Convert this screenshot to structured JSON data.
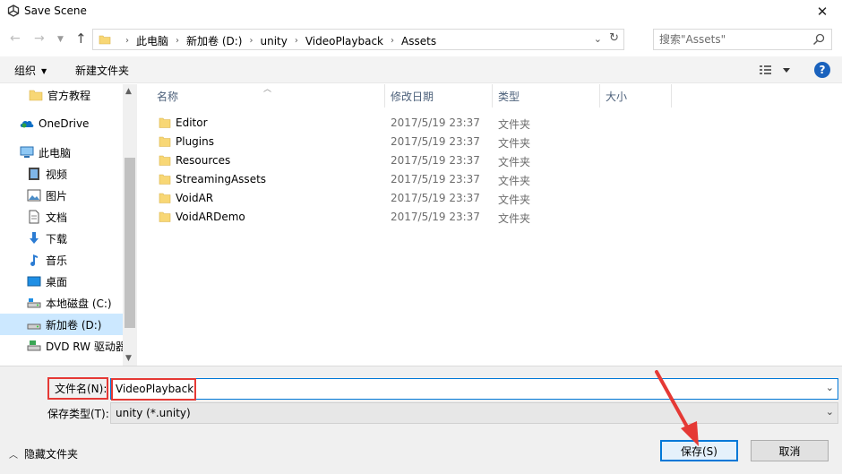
{
  "window": {
    "title": "Save Scene",
    "close_glyph": "✕"
  },
  "address": {
    "crumbs": [
      "此电脑",
      "新加卷 (D:)",
      "unity",
      "VideoPlayback",
      "Assets"
    ],
    "search_placeholder": "搜索\"Assets\""
  },
  "toolbar": {
    "organize_label": "组织",
    "new_folder_label": "新建文件夹",
    "help_label": "?"
  },
  "nav_pane": {
    "items": [
      {
        "label": "官方教程",
        "icon": "folder-icon"
      },
      {
        "label": "OneDrive",
        "icon": "onedrive-icon"
      },
      {
        "label": "此电脑",
        "icon": "computer-icon"
      },
      {
        "label": "视频",
        "icon": "video-icon"
      },
      {
        "label": "图片",
        "icon": "picture-icon"
      },
      {
        "label": "文档",
        "icon": "document-icon"
      },
      {
        "label": "下载",
        "icon": "download-icon"
      },
      {
        "label": "音乐",
        "icon": "music-icon"
      },
      {
        "label": "桌面",
        "icon": "desktop-icon"
      },
      {
        "label": "本地磁盘 (C:)",
        "icon": "drive-icon"
      },
      {
        "label": "新加卷 (D:)",
        "icon": "drive-icon",
        "selected": true
      },
      {
        "label": "DVD RW 驱动器",
        "icon": "dvd-icon"
      }
    ]
  },
  "file_list": {
    "columns": [
      "名称",
      "修改日期",
      "类型",
      "大小"
    ],
    "rows": [
      {
        "name": "Editor",
        "date": "2017/5/19 23:37",
        "type": "文件夹"
      },
      {
        "name": "Plugins",
        "date": "2017/5/19 23:37",
        "type": "文件夹"
      },
      {
        "name": "Resources",
        "date": "2017/5/19 23:37",
        "type": "文件夹"
      },
      {
        "name": "StreamingAssets",
        "date": "2017/5/19 23:37",
        "type": "文件夹"
      },
      {
        "name": "VoidAR",
        "date": "2017/5/19 23:37",
        "type": "文件夹"
      },
      {
        "name": "VoidARDemo",
        "date": "2017/5/19 23:37",
        "type": "文件夹"
      }
    ]
  },
  "save_form": {
    "filename_label": "文件名(N):",
    "filename_value": "VideoPlayback",
    "filetype_label": "保存类型(T):",
    "filetype_value": "unity (*.unity)",
    "hide_folders_label": "隐藏文件夹",
    "save_label": "保存(S)",
    "cancel_label": "取消"
  },
  "colors": {
    "accent": "#0078d7",
    "annotation_red": "#e53935",
    "folder_yellow": "#f8d775"
  }
}
